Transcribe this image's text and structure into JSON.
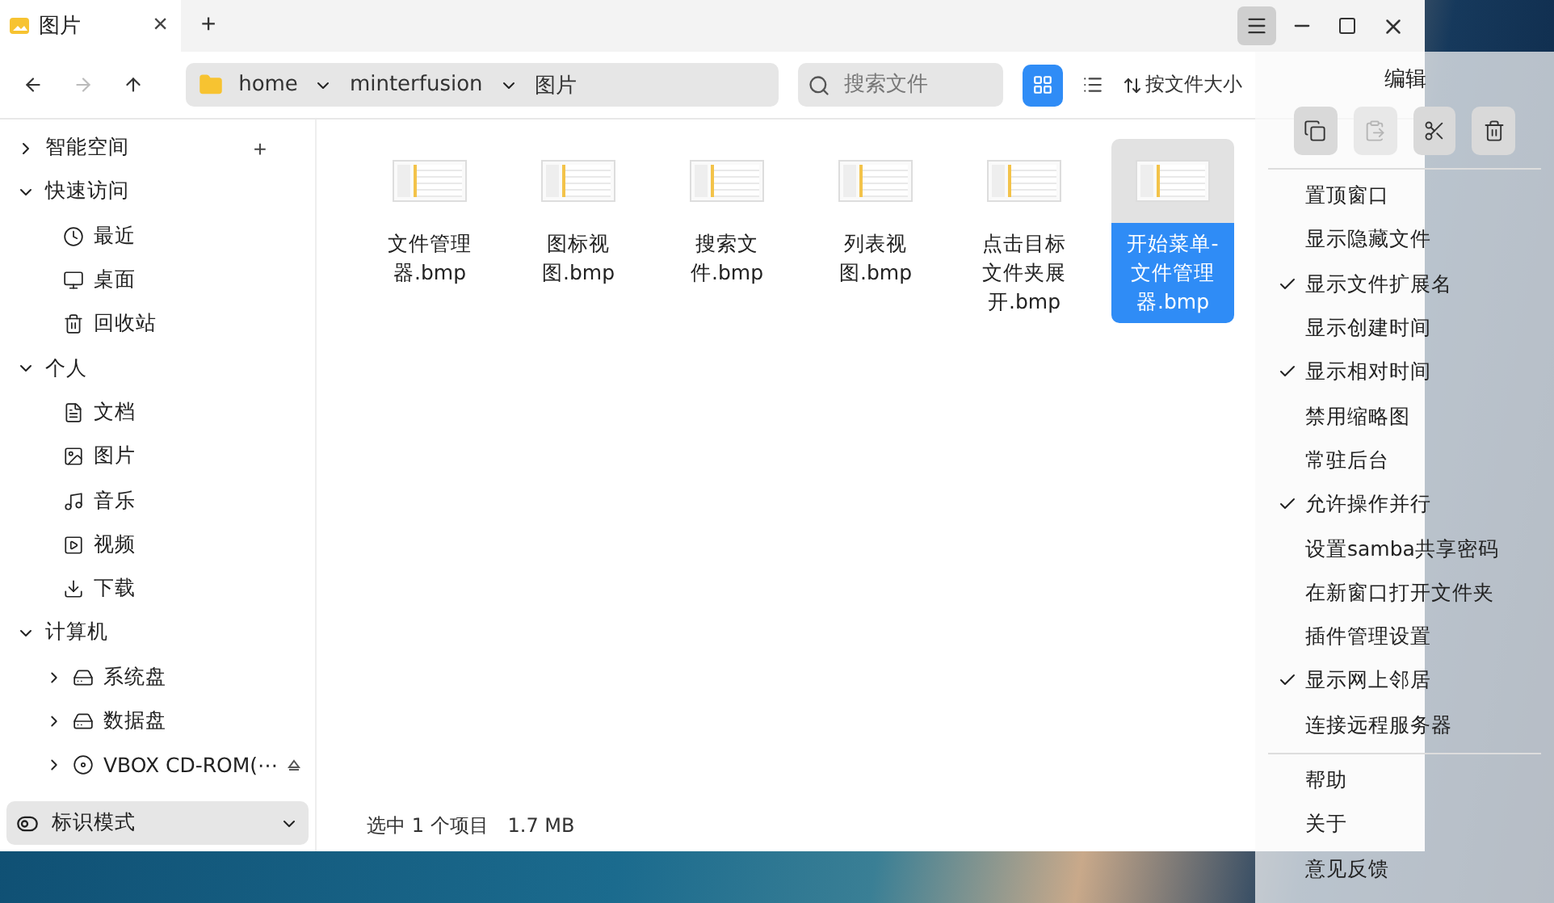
{
  "tabs": [
    {
      "label": "图片",
      "selected": true,
      "close": "×"
    }
  ],
  "new_tab": "+",
  "breadcrumb": [
    "home",
    "minterfusion",
    "图片"
  ],
  "search": {
    "placeholder": "搜索文件"
  },
  "view_modes": [
    {
      "kind": "grid",
      "selected": true
    },
    {
      "kind": "list",
      "selected": false
    }
  ],
  "sort": {
    "label": "按文件大小"
  },
  "sidebar": {
    "groups": [
      {
        "label": "智能空间",
        "expanded": false,
        "action": "+"
      },
      {
        "label": "快速访问",
        "expanded": true,
        "children": [
          {
            "label": "最近",
            "kind": "clock"
          },
          {
            "label": "桌面",
            "kind": "monitor"
          },
          {
            "label": "回收站",
            "kind": "trash"
          }
        ]
      },
      {
        "label": "个人",
        "expanded": true,
        "children": [
          {
            "label": "文档",
            "kind": "document"
          },
          {
            "label": "图片",
            "kind": "image"
          },
          {
            "label": "音乐",
            "kind": "music"
          },
          {
            "label": "视频",
            "kind": "video"
          },
          {
            "label": "下载",
            "kind": "download"
          }
        ]
      },
      {
        "label": "计算机",
        "expanded": true,
        "children": [
          {
            "label": "系统盘",
            "kind": "disk",
            "expanded": false
          },
          {
            "label": "数据盘",
            "kind": "disk",
            "expanded": false
          },
          {
            "label": "VBOX CD-ROM(⋯",
            "kind": "optical",
            "expanded": false,
            "ejectable": true
          }
        ]
      }
    ],
    "mode": {
      "label": "标识模式"
    }
  },
  "files": [
    {
      "name": "文件管理器.bmp",
      "selected": false
    },
    {
      "name": "图标视图.bmp",
      "selected": false
    },
    {
      "name": "搜索文件.bmp",
      "selected": false
    },
    {
      "name": "列表视图.bmp",
      "selected": false
    },
    {
      "name": "点击目标文件夹展开.bmp",
      "selected": false
    },
    {
      "name": "开始菜单-文件管理器.bmp",
      "selected": true
    }
  ],
  "status_bar": [
    "选中 1 个项目",
    "1.7 MB"
  ],
  "menu": {
    "title": "编辑",
    "actions": [
      {
        "kind": "copy",
        "disabled": false
      },
      {
        "kind": "paste",
        "disabled": true
      },
      {
        "kind": "cut",
        "disabled": false
      },
      {
        "kind": "delete",
        "disabled": false
      }
    ],
    "items": [
      {
        "label": "置顶窗口",
        "checked": false
      },
      {
        "label": "显示隐藏文件",
        "checked": false
      },
      {
        "label": "显示文件扩展名",
        "checked": true
      },
      {
        "label": "显示创建时间",
        "checked": false
      },
      {
        "label": "显示相对时间",
        "checked": true
      },
      {
        "label": "禁用缩略图",
        "checked": false
      },
      {
        "label": "常驻后台",
        "checked": false
      },
      {
        "label": "允许操作并行",
        "checked": true
      },
      {
        "label": "设置samba共享密码",
        "checked": false
      },
      {
        "label": "在新窗口打开文件夹",
        "checked": false
      },
      {
        "label": "插件管理设置",
        "checked": false
      },
      {
        "label": "显示网上邻居",
        "checked": true
      },
      {
        "label": "连接远程服务器",
        "checked": false
      }
    ],
    "footer": [
      "帮助",
      "关于",
      "意见反馈"
    ]
  }
}
